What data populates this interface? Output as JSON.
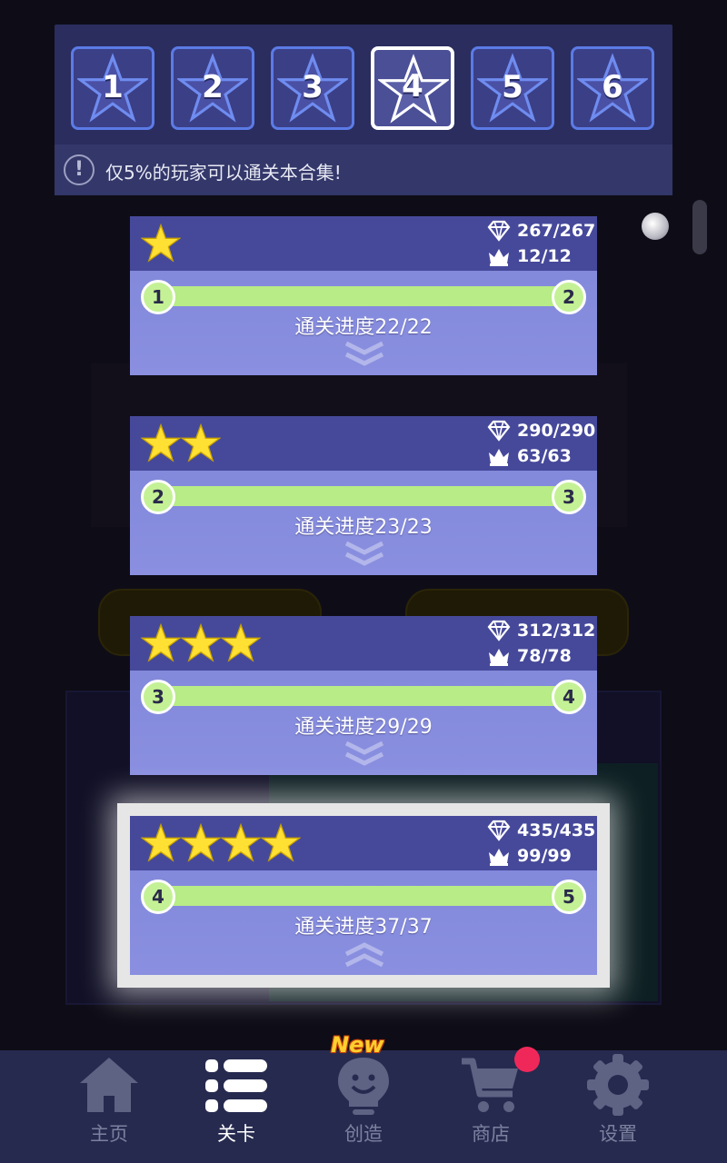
{
  "colors": {
    "background": "#0e0d17",
    "panel": "#2a2d5e",
    "card_header": "#46499a",
    "card_body": "#8a8fe0",
    "progress_bar": "#b7ec86",
    "star_yellow": "#ffe033",
    "nav_bg": "#262a4f",
    "badge_red": "#f0285a"
  },
  "star_selector": {
    "tiles": [
      {
        "label": "1",
        "active": false
      },
      {
        "label": "2",
        "active": false
      },
      {
        "label": "3",
        "active": false
      },
      {
        "label": "4",
        "active": true
      },
      {
        "label": "5",
        "active": false
      },
      {
        "label": "6",
        "active": false
      }
    ],
    "info_icon": "exclamation-circle-icon",
    "info_text": "仅5%的玩家可以通关本合集!"
  },
  "cards": [
    {
      "stars": 1,
      "gems": "267/267",
      "crowns": "12/12",
      "from": "1",
      "to": "2",
      "progress": "通关进度22/22",
      "chevron": "chevron-down-icon"
    },
    {
      "stars": 2,
      "gems": "290/290",
      "crowns": "63/63",
      "from": "2",
      "to": "3",
      "progress": "通关进度23/23",
      "chevron": "chevron-down-icon"
    },
    {
      "stars": 3,
      "gems": "312/312",
      "crowns": "78/78",
      "from": "3",
      "to": "4",
      "progress": "通关进度29/29",
      "chevron": "chevron-down-icon"
    },
    {
      "stars": 4,
      "gems": "435/435",
      "crowns": "99/99",
      "from": "4",
      "to": "5",
      "progress": "通关进度37/37",
      "chevron": "chevron-up-icon"
    }
  ],
  "nav": {
    "items": [
      {
        "label": "主页",
        "icon": "home-icon",
        "active": false
      },
      {
        "label": "关卡",
        "icon": "list-icon",
        "active": true
      },
      {
        "label": "创造",
        "icon": "lightbulb-icon",
        "active": false
      },
      {
        "label": "商店",
        "icon": "cart-icon",
        "active": false
      },
      {
        "label": "设置",
        "icon": "gear-icon",
        "active": false
      }
    ],
    "new_badge": "New"
  }
}
